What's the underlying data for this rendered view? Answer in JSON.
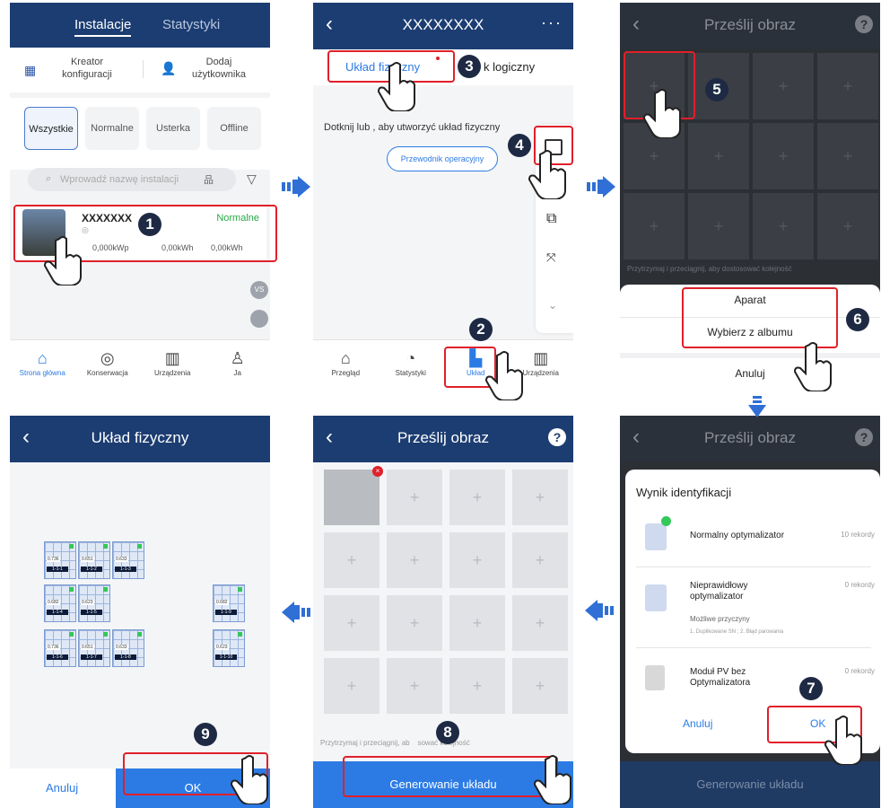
{
  "panel1": {
    "tabs": [
      "Instalacje",
      "Statystyki"
    ],
    "actions": [
      "Kreator konfiguracji",
      "Dodaj użytkownika"
    ],
    "filters": [
      "Wszystkie",
      "Normalne",
      "Usterka",
      "Offline"
    ],
    "search_placeholder": "Wprowadź nazwę instalacji",
    "plant": {
      "name": "XXXXXXX",
      "status": "Normalne",
      "capacity": "0,000kWp",
      "energy1": "0,00kWh",
      "energy2": "0,00kWh"
    },
    "side_badge": "VS",
    "nav": [
      "Strona główna",
      "Konserwacja",
      "Urządzenia",
      "Ja"
    ]
  },
  "panel2": {
    "title": "XXXXXXXX",
    "tab_physical": "Układ fizyczny",
    "tab_logical": "k logiczny",
    "hint": "Dotknij  lub , aby utworzyć układ fizyczny",
    "guide_button": "Przewodnik operacyjny",
    "nav": [
      "Przegląd",
      "Statystyki",
      "Układ",
      "Urządzenia"
    ]
  },
  "panel3": {
    "title": "Prześlij obraz",
    "hint": "Przytrzymaj i przeciągnij, aby dostosować kolejność",
    "sheet": [
      "Aparat",
      "Wybierz z albumu",
      "Anuluj"
    ]
  },
  "panel4": {
    "title": "Układ fizyczny",
    "modules": [
      {
        "val": "0.736",
        "id": "1-1-1"
      },
      {
        "val": "0.651",
        "id": "1-1-2"
      },
      {
        "val": "0.633",
        "id": "1-1-3"
      },
      {
        "val": "0.682",
        "id": "1-1-4"
      },
      {
        "val": "0.623",
        "id": "1-1-5"
      },
      {
        "val": "0.736",
        "id": "1-1-6"
      },
      {
        "val": "0.651",
        "id": "1-1-7"
      },
      {
        "val": "0.633",
        "id": "1-1-8"
      },
      {
        "val": "0.682",
        "id": "1-1-9"
      },
      {
        "val": "0.623",
        "id": "1-1-10"
      }
    ],
    "cancel": "Anuluj",
    "ok": "OK"
  },
  "panel5": {
    "title": "Prześlij obraz",
    "hint": "Przytrzymaj i przeciągnij, ab    sować kolejność",
    "generate": "Generowanie układu"
  },
  "panel6": {
    "title": "Prześlij obraz",
    "result_title": "Wynik identyfikacji",
    "items": [
      {
        "label": "Normalny optymalizator",
        "count": "10 rekordy"
      },
      {
        "label": "Nieprawidłowy optymalizator",
        "count": "0 rekordy",
        "sub": "Możliwe przyczyny",
        "reasons": "1. Duplikowane SN ; 2. Błąd parowania"
      },
      {
        "label": "Moduł PV bez Optymalizatora",
        "count": "0 rekordy"
      }
    ],
    "cancel": "Anuluj",
    "ok": "OK",
    "generate": "Generowanie układu"
  },
  "steps": [
    "1",
    "2",
    "3",
    "4",
    "5",
    "6",
    "7",
    "8",
    "9"
  ],
  "colors": {
    "navy": "#1c3d72",
    "blue": "#2c7be5",
    "red": "#e0202a",
    "green": "#34c759"
  }
}
